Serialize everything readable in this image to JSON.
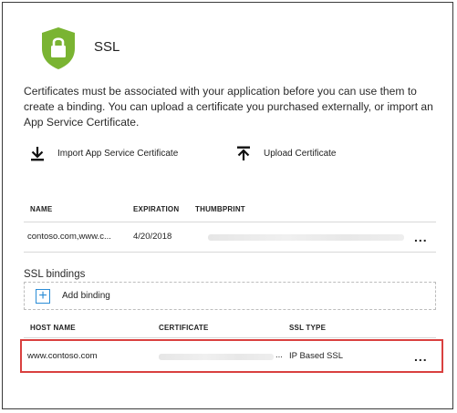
{
  "header": {
    "title": "SSL",
    "icon": "ssl-lock-shield-icon",
    "icon_color": "#7ab432"
  },
  "description": "Certificates must be associated with your application before you can use them to create a binding. You can upload a certificate you purchased externally, or import an App Service Certificate.",
  "actions": {
    "import_label": "Import App Service Certificate",
    "upload_label": "Upload Certificate"
  },
  "certificates": {
    "columns": [
      "NAME",
      "EXPIRATION",
      "THUMBPRINT"
    ],
    "rows": [
      {
        "name": "contoso.com,www.c...",
        "expiration": "4/20/2018",
        "thumbprint": "",
        "more": "..."
      }
    ]
  },
  "bindings": {
    "section_label": "SSL bindings",
    "add_label": "Add binding",
    "columns": [
      "HOST NAME",
      "CERTIFICATE",
      "SSL TYPE"
    ],
    "rows": [
      {
        "host": "www.contoso.com",
        "certificate_suffix": "...",
        "ssl_type": "IP Based SSL",
        "more": "..."
      }
    ]
  },
  "colors": {
    "accent": "#2a8cd6",
    "highlight": "#d9403f",
    "shield": "#7ab432"
  }
}
